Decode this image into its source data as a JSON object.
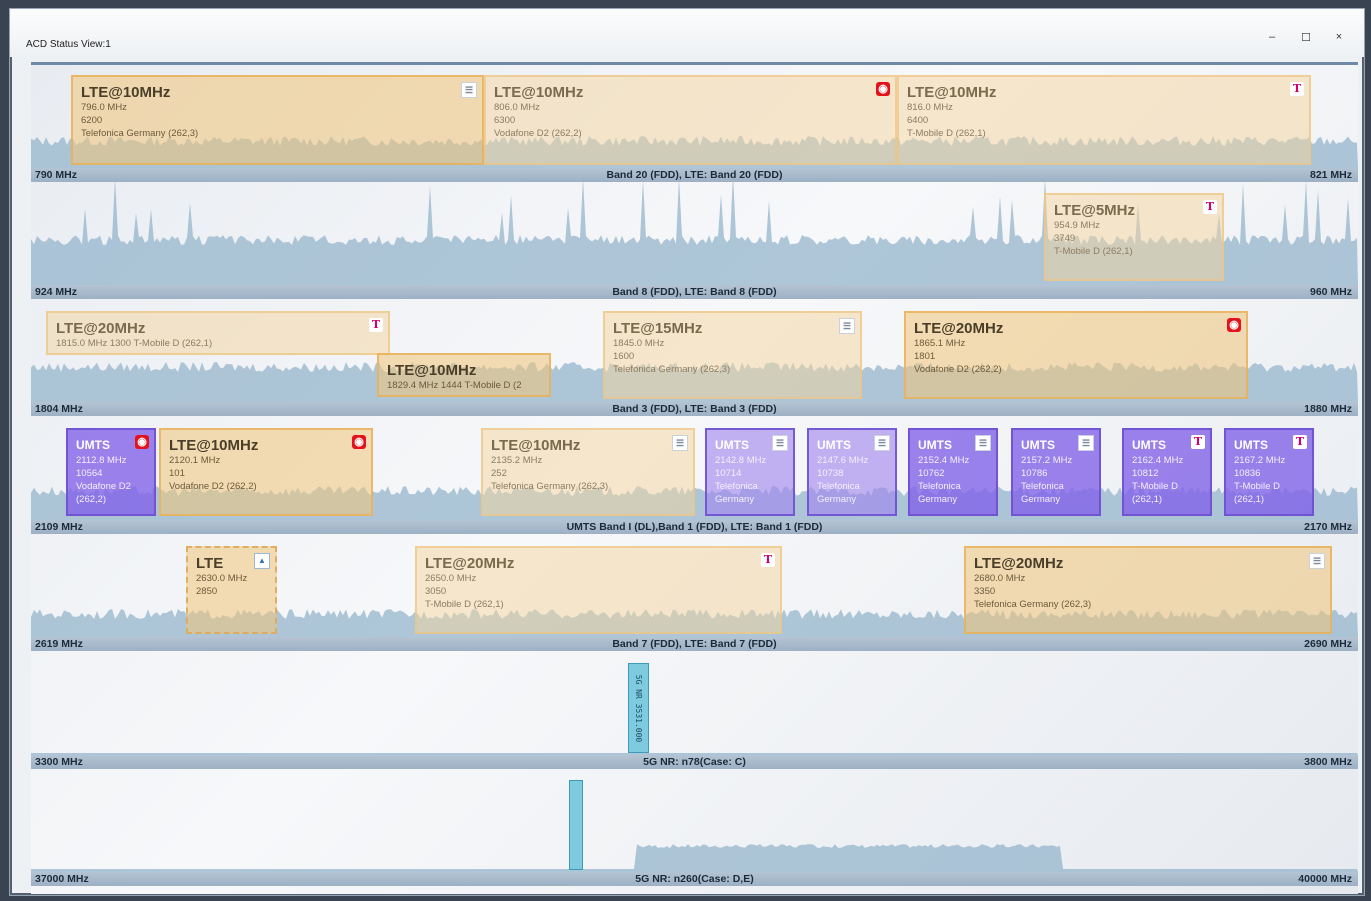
{
  "window": {
    "title": "ACD Status View:1",
    "controls": [
      "–",
      "☐",
      "×"
    ]
  },
  "colors": {
    "band_bar": "#a8bacb",
    "spectrum_fill": "#8fb0c9",
    "lte_carrier": "#f0c478",
    "umts_carrier": "#8060e8",
    "nr_carrier": "#7ecbe0"
  },
  "bands": [
    {
      "low": "790 MHz",
      "name": "Band 20 (FDD), LTE: Band 20 (FDD)",
      "high": "821 MHz",
      "carriers": [
        {
          "type": "lte",
          "title": "LTE@10MHz",
          "lines": [
            "796.0 MHz",
            "6200",
            "Telefonica Germany (262,3)"
          ],
          "icon": "menu-icon"
        },
        {
          "type": "lte",
          "title": "LTE@10MHz",
          "lines": [
            "806.0 MHz",
            "6300",
            "Vodafone D2 (262,2)"
          ],
          "icon": "vodafone-icon"
        },
        {
          "type": "lte",
          "title": "LTE@10MHz",
          "lines": [
            "816.0 MHz",
            "6400",
            "T-Mobile D (262,1)"
          ],
          "icon": "tmobile-icon"
        }
      ]
    },
    {
      "low": "924 MHz",
      "name": "Band 8 (FDD), LTE: Band 8 (FDD)",
      "high": "960 MHz",
      "carriers": [
        {
          "type": "lte",
          "title": "LTE@5MHz",
          "lines": [
            "954.9 MHz",
            "3749",
            "T-Mobile D (262,1)"
          ],
          "icon": "tmobile-icon"
        }
      ]
    },
    {
      "low": "1804 MHz",
      "name": "Band 3 (FDD), LTE: Band 3 (FDD)",
      "high": "1880 MHz",
      "carriers": [
        {
          "type": "lte",
          "title": "LTE@20MHz",
          "lines": [
            "1815.0 MHz   1300   T-Mobile D (262,1)"
          ],
          "icon": "tmobile-icon"
        },
        {
          "type": "lte",
          "title": "LTE@10MHz",
          "lines": [
            "1829.4 MHz   1444   T-Mobile D (2"
          ],
          "icon": ""
        },
        {
          "type": "lte",
          "title": "LTE@15MHz",
          "lines": [
            "1845.0 MHz",
            "1600",
            "Telefonica Germany (262,3)"
          ],
          "icon": "menu-icon"
        },
        {
          "type": "lte",
          "title": "LTE@20MHz",
          "lines": [
            "1865.1 MHz",
            "1801",
            "Vodafone D2 (262,2)"
          ],
          "icon": "vodafone-icon"
        }
      ]
    },
    {
      "low": "2109 MHz",
      "name": "UMTS Band I (DL),Band 1 (FDD), LTE: Band 1 (FDD)",
      "high": "2170 MHz",
      "carriers": [
        {
          "type": "umts",
          "title": "UMTS",
          "lines": [
            "2112.8 MHz",
            "10564",
            "Vodafone D2",
            "(262,2)"
          ],
          "icon": "vodafone-icon"
        },
        {
          "type": "lte",
          "title": "LTE@10MHz",
          "lines": [
            "2120.1 MHz",
            "101",
            "Vodafone D2 (262,2)"
          ],
          "icon": "vodafone-icon"
        },
        {
          "type": "lte",
          "title": "LTE@10MHz",
          "lines": [
            "2135.2 MHz",
            "252",
            "Telefonica Germany (262,3)"
          ],
          "icon": "menu-icon"
        },
        {
          "type": "umts",
          "title": "UMTS",
          "lines": [
            "2142.8 MHz",
            "10714",
            "Telefonica",
            "Germany"
          ],
          "icon": "menu-icon"
        },
        {
          "type": "umts",
          "title": "UMTS",
          "lines": [
            "2147.6 MHz",
            "10738",
            "Telefonica",
            "Germany"
          ],
          "icon": "menu-icon"
        },
        {
          "type": "umts",
          "title": "UMTS",
          "lines": [
            "2152.4 MHz",
            "10762",
            "Telefonica",
            "Germany"
          ],
          "icon": "menu-icon"
        },
        {
          "type": "umts",
          "title": "UMTS",
          "lines": [
            "2157.2 MHz",
            "10786",
            "Telefonica",
            "Germany"
          ],
          "icon": "menu-icon"
        },
        {
          "type": "umts",
          "title": "UMTS",
          "lines": [
            "2162.4 MHz",
            "10812",
            "T-Mobile D",
            "(262,1)"
          ],
          "icon": "tmobile-icon"
        },
        {
          "type": "umts",
          "title": "UMTS",
          "lines": [
            "2167.2 MHz",
            "10836",
            "T-Mobile D",
            "(262,1)"
          ],
          "icon": "tmobile-icon"
        }
      ]
    },
    {
      "low": "2619 MHz",
      "name": "Band 7 (FDD), LTE: Band 7 (FDD)",
      "high": "2690 MHz",
      "carriers": [
        {
          "type": "lte",
          "title": "LTE",
          "lines": [
            "2630.0 MHz",
            "2850"
          ],
          "icon": "tower-icon"
        },
        {
          "type": "lte",
          "title": "LTE@20MHz",
          "lines": [
            "2650.0 MHz",
            "3050",
            "T-Mobile D (262,1)"
          ],
          "icon": "tmobile-icon"
        },
        {
          "type": "lte",
          "title": "LTE@20MHz",
          "lines": [
            "2680.0 MHz",
            "3350",
            "Telefonica Germany (262,3)"
          ],
          "icon": "menu-icon"
        }
      ]
    },
    {
      "low": "3300 MHz",
      "name": "5G NR: n78(Case: C)",
      "high": "3800 MHz",
      "carriers": [
        {
          "type": "nr",
          "title": "5G NR 3531.000",
          "lines": [],
          "icon": ""
        }
      ]
    },
    {
      "low": "37000 MHz",
      "name": "5G NR: n260(Case: D,E)",
      "high": "40000 MHz",
      "carriers": [
        {
          "type": "nr",
          "title": "",
          "lines": [],
          "icon": ""
        }
      ]
    }
  ]
}
